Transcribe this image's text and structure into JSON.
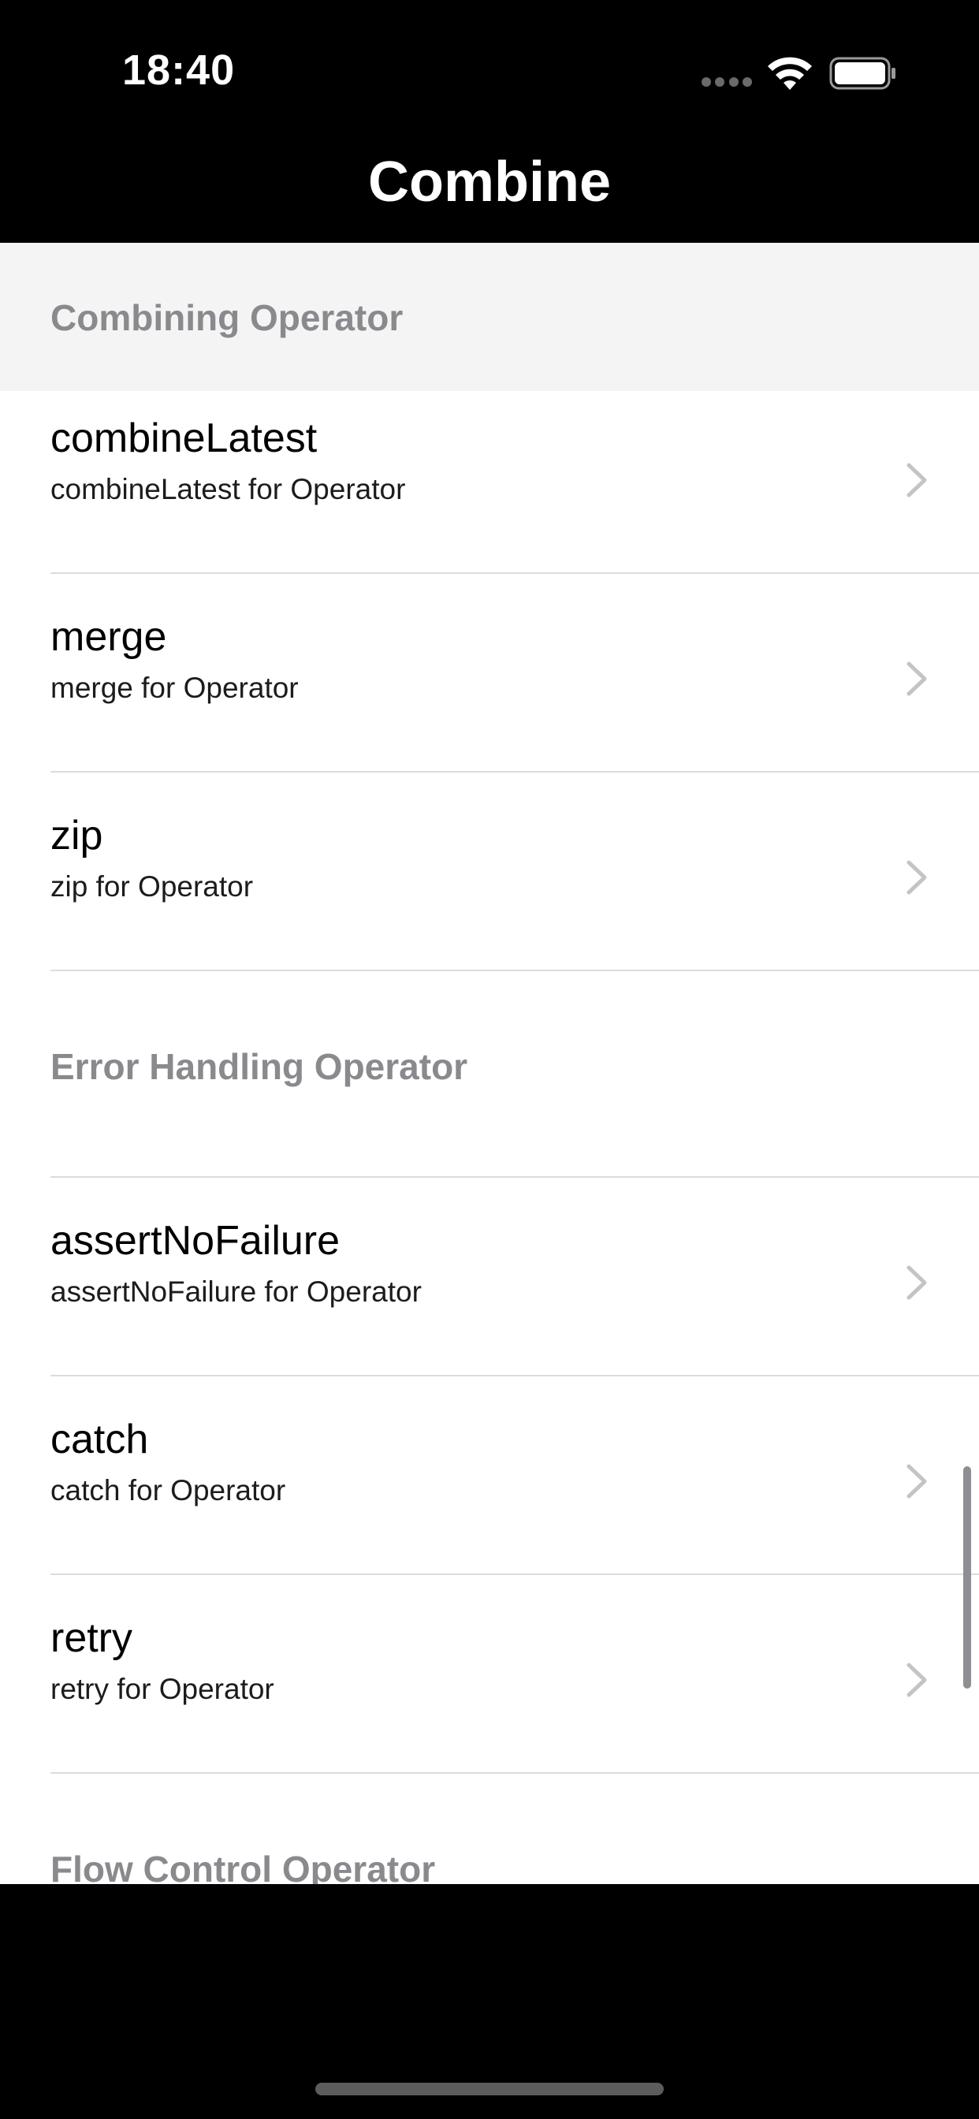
{
  "status_bar": {
    "time": "18:40",
    "signal_icon": "cellular-signal-icon",
    "wifi_icon": "wifi-icon",
    "battery_icon": "battery-icon"
  },
  "nav": {
    "title": "Combine"
  },
  "sections": [
    {
      "header": "Combining Operator",
      "rows": [
        {
          "title": "combineLatest",
          "subtitle": "combineLatest for Operator"
        },
        {
          "title": "merge",
          "subtitle": "merge for Operator"
        },
        {
          "title": "zip",
          "subtitle": "zip for Operator"
        }
      ]
    },
    {
      "header": "Error Handling Operator",
      "rows": [
        {
          "title": "assertNoFailure",
          "subtitle": "assertNoFailure for Operator"
        },
        {
          "title": "catch",
          "subtitle": "catch for Operator"
        },
        {
          "title": "retry",
          "subtitle": "retry for Operator"
        }
      ]
    },
    {
      "header": "Flow Control Operator"
    }
  ],
  "colors": {
    "background": "#000000",
    "list_background": "#ffffff",
    "sticky_header_background": "#f4f4f4",
    "section_header_text": "#8a8a8e",
    "separator": "#dcdcdf",
    "chevron": "#c4c4c7"
  }
}
